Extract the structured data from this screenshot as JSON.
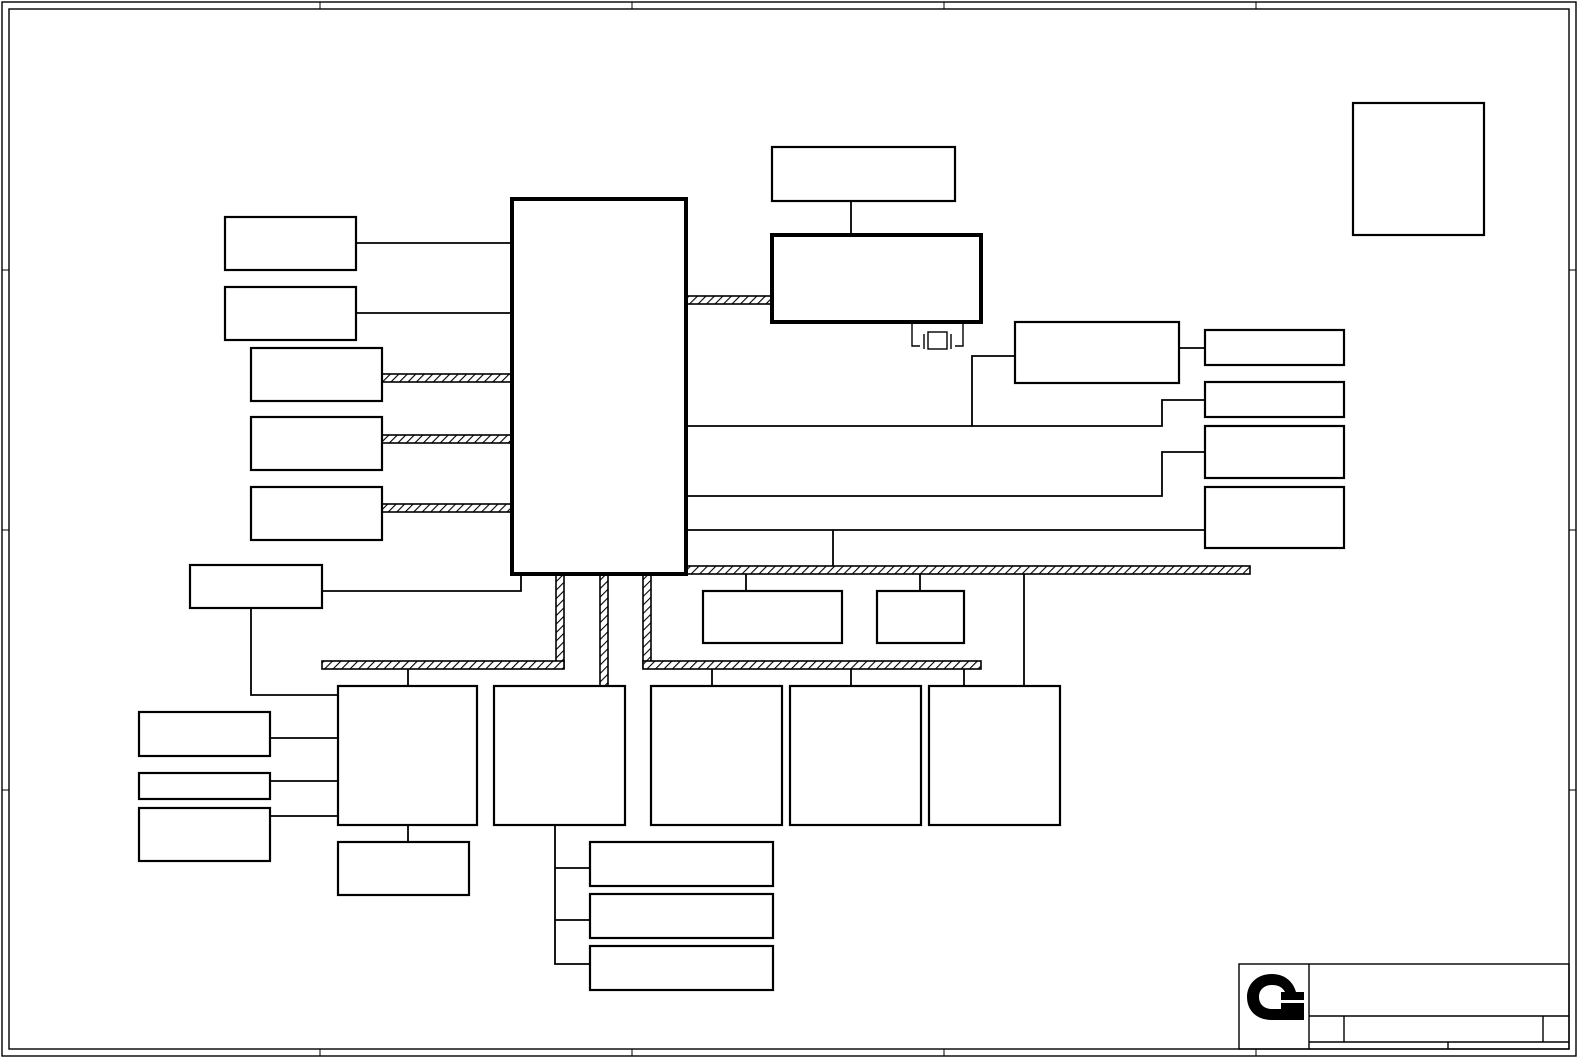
{
  "drawing": {
    "sheet": "block-diagram",
    "logo_icon": "quanta-q-logo",
    "title_block": {
      "title": "",
      "sheet_size": "",
      "doc_number": "",
      "rev": ""
    }
  }
}
